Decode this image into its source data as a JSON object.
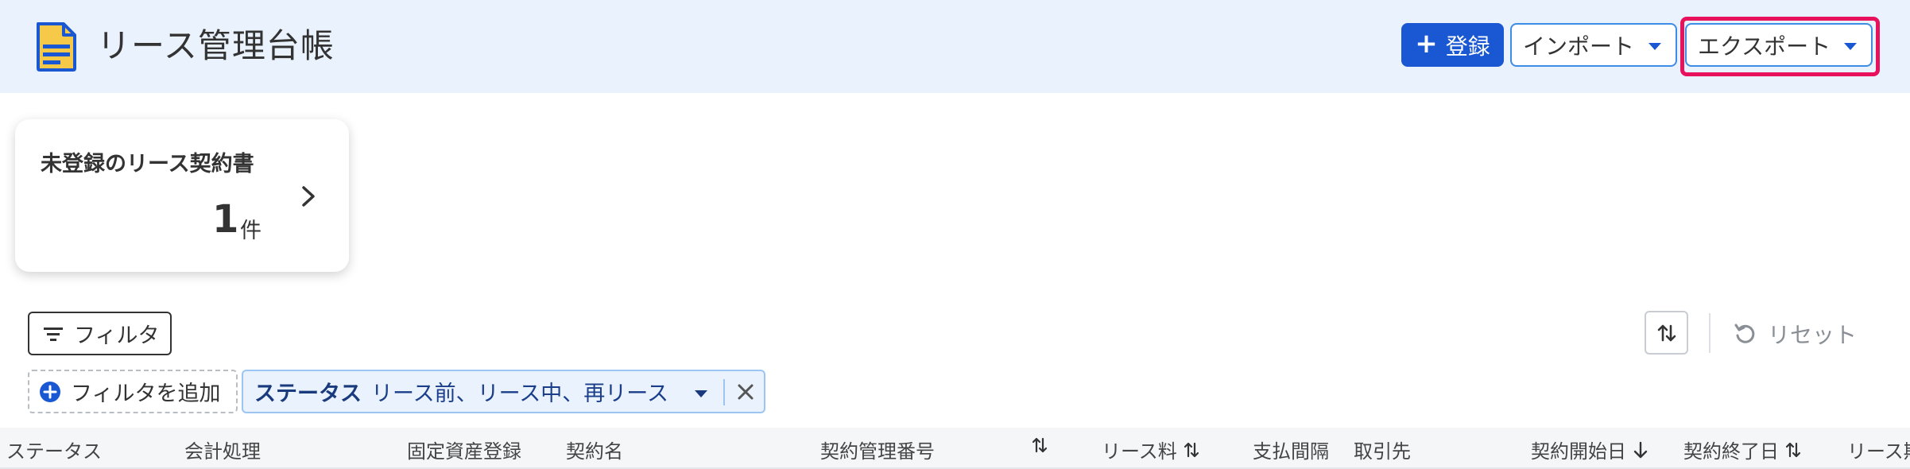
{
  "header": {
    "title": "リース管理台帳",
    "register_label": "登録",
    "import_label": "インポート",
    "export_label": "エクスポート"
  },
  "card": {
    "title": "未登録のリース契約書",
    "count": "1",
    "unit": "件"
  },
  "toolbar": {
    "filter_label": "フィルタ",
    "reset_label": "リセット",
    "add_filter_label": "フィルタを追加"
  },
  "chip": {
    "label": "ステータス",
    "values": "リース前、リース中、再リース"
  },
  "table": {
    "columns": [
      {
        "label": "ステータス"
      },
      {
        "label": "会計処理"
      },
      {
        "label": "固定資産登録"
      },
      {
        "label": "契約名"
      },
      {
        "label": "契約管理番号"
      },
      {
        "label": ""
      },
      {
        "label": "リース料"
      },
      {
        "label": "支払間隔"
      },
      {
        "label": "取引先"
      },
      {
        "label": "契約開始日"
      },
      {
        "label": "契約終了日"
      },
      {
        "label": "リース期"
      }
    ]
  },
  "colors": {
    "header_bg": "#eaf3fd",
    "primary": "#1a57d3",
    "highlight": "#e8115b",
    "chip_bg": "#e9f2fd"
  }
}
